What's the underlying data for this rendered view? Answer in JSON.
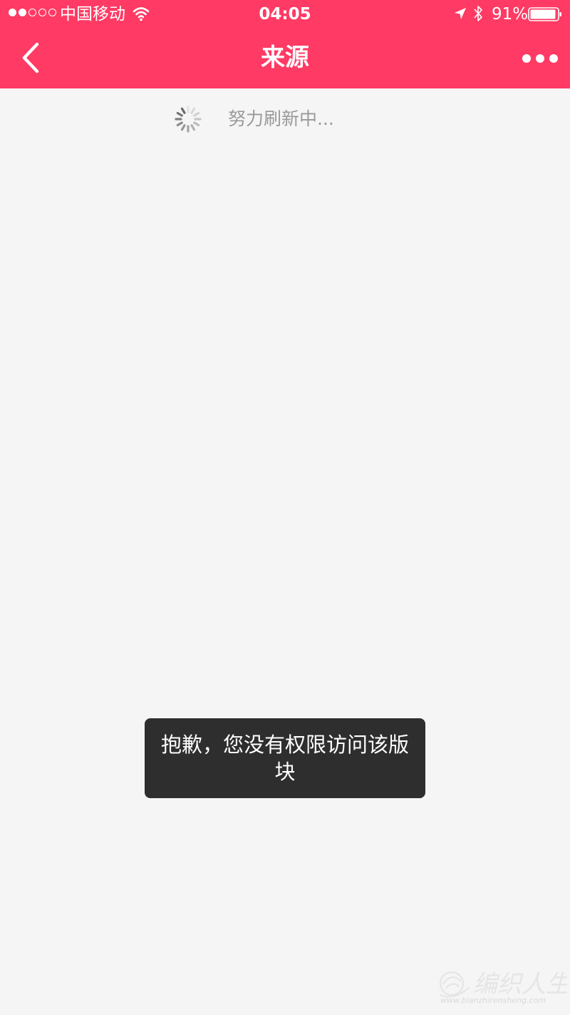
{
  "status_bar": {
    "carrier": "中国移动",
    "time": "04:05",
    "battery": "91%",
    "icons": [
      "signal-dots",
      "wifi-icon",
      "location-icon",
      "bluetooth-icon",
      "battery-icon"
    ]
  },
  "nav": {
    "title": "来源",
    "back_icon": "chevron-left-icon",
    "more_icon": "more-dots-icon"
  },
  "content": {
    "refresh_text": "努力刷新中...",
    "spinner_icon": "spinner-icon"
  },
  "toast": {
    "message": "抱歉，您没有权限访问该版块"
  },
  "watermark": {
    "brand": "编织人生",
    "url": "www.bianzhirensheng.com"
  },
  "colors": {
    "accent": "#ff3a64",
    "background": "#f5f5f5",
    "toast_bg": "#2e2e2e",
    "muted_text": "#9a9a9a"
  }
}
